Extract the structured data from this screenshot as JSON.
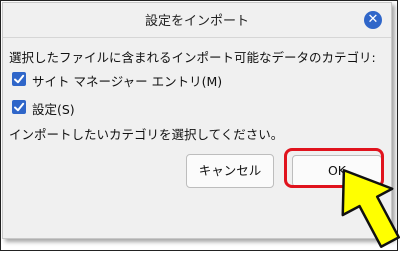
{
  "dialog": {
    "title": "設定をインポート",
    "close_icon": "close-icon",
    "description": "選択したファイルに含まれるインポート可能なデータのカテゴリ:",
    "items": [
      {
        "label": "サイト マネージャー エントリ(M)",
        "checked": true
      },
      {
        "label": "設定(S)",
        "checked": true
      }
    ],
    "instruction": "インポートしたいカテゴリを選択してください。",
    "cancel_label": "キャンセル",
    "ok_label": "OK"
  },
  "colors": {
    "accent": "#2f66c9",
    "highlight": "#e0131d",
    "pointer": "#ffff00"
  }
}
